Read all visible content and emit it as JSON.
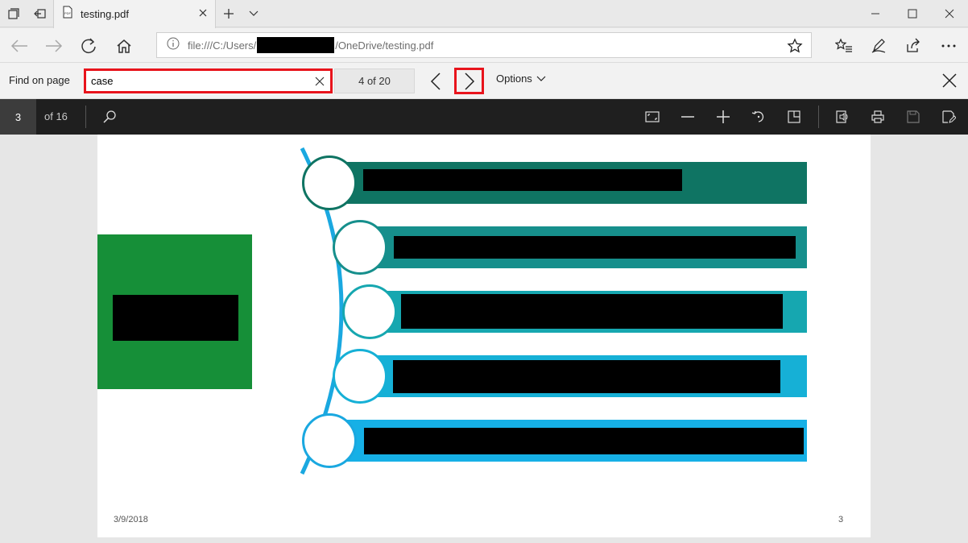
{
  "browser": {
    "tab": {
      "title": "testing.pdf"
    },
    "address": {
      "url_prefix": "file:///C:/Users/",
      "url_suffix": "/OneDrive/testing.pdf"
    }
  },
  "find_bar": {
    "label": "Find on page",
    "query": "case",
    "match_count": "4 of 20",
    "options_label": "Options"
  },
  "pdf_toolbar": {
    "current_page": "3",
    "page_total": "of 16"
  },
  "slide": {
    "footer_date": "3/9/2018",
    "footer_page": "3",
    "colors": {
      "green_box": "#168f38",
      "bar1": "#0f7463",
      "bar2": "#168f8c",
      "bar3": "#16a7b0",
      "bar4": "#16b0d6",
      "bar5": "#16b0e6",
      "arc": "#1aa8e0"
    }
  }
}
